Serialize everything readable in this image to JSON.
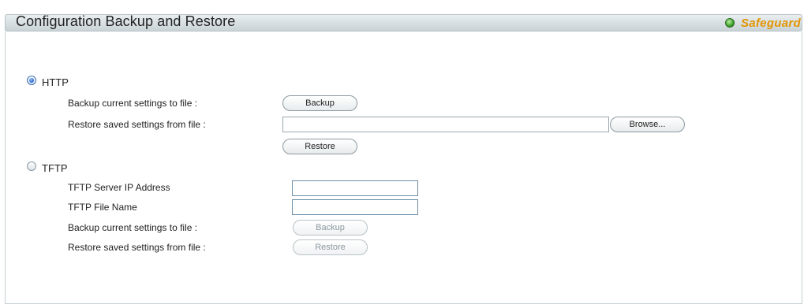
{
  "header": {
    "title": "Configuration Backup and Restore",
    "safeguard_label": "Safeguard",
    "safeguard_icon": "status-dot-icon",
    "safeguard_color": "#e39400"
  },
  "http": {
    "label": "HTTP",
    "selected": true,
    "backup_label": "Backup current settings to file :",
    "backup_button": "Backup",
    "restore_label": "Restore saved settings from file :",
    "file_value": "",
    "browse_button": "Browse...",
    "restore_button": "Restore"
  },
  "tftp": {
    "label": "TFTP",
    "selected": false,
    "server_ip_label": "TFTP Server IP Address",
    "server_ip_value": "",
    "file_name_label": "TFTP File Name",
    "file_name_value": "",
    "backup_label": "Backup current settings to file :",
    "backup_button": "Backup",
    "restore_label": "Restore saved settings from file :",
    "restore_button": "Restore"
  }
}
